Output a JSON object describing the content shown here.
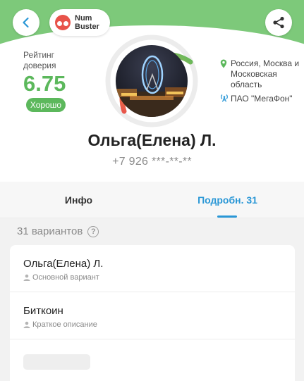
{
  "header": {
    "logo_line1": "Num",
    "logo_line2": "Buster",
    "icons": {
      "back": "back-chevron-icon",
      "share": "share-icon",
      "logo": "owl-logo-icon"
    },
    "colors": {
      "header_green": "#7dc97a",
      "accent_blue": "#2a97d6"
    }
  },
  "rating": {
    "label": "Рейтинг доверия",
    "value": "6.75",
    "badge": "Хорошо",
    "color": "#5cb85c"
  },
  "profile": {
    "location": "Россия, Москва и Московская область",
    "operator": "ПАО \"МегаФон\"",
    "name": "Ольга(Елена) Л.",
    "phone": "+7 926 ***-**-**",
    "icons": {
      "location": "location-pin-icon",
      "operator": "signal-tower-icon"
    }
  },
  "tabs": [
    {
      "label": "Инфо",
      "active": false
    },
    {
      "label": "Подробн. 31",
      "active": true
    }
  ],
  "variants": {
    "heading": "31 вариантов",
    "items": [
      {
        "title": "Ольга(Елена) Л.",
        "subtitle": "Основной вариант"
      },
      {
        "title": "Биткоин",
        "subtitle": "Краткое описание"
      }
    ]
  }
}
